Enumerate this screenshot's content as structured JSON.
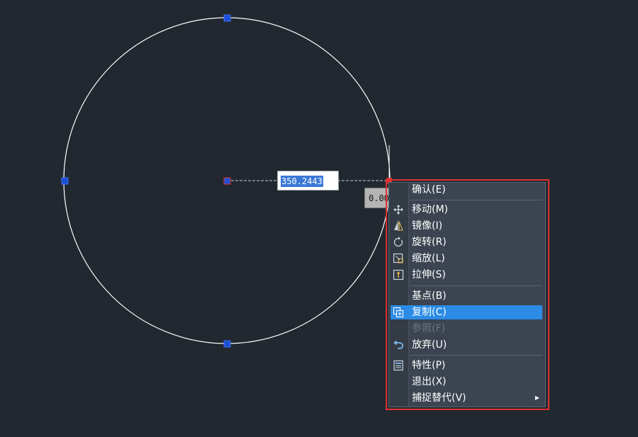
{
  "dimension_input": {
    "value": "350.2443"
  },
  "angle_input": {
    "value": "0.00"
  },
  "colors": {
    "background": "#212830",
    "grip": "#1e4fd8",
    "selection": "#2b8be6",
    "highlight_border": "#e03131"
  },
  "context_menu": {
    "items": [
      {
        "label": "确认(E)",
        "icon": null
      },
      {
        "label": "移动(M)",
        "icon": "move-icon"
      },
      {
        "label": "镜像(I)",
        "icon": "mirror-icon"
      },
      {
        "label": "旋转(R)",
        "icon": "rotate-icon"
      },
      {
        "label": "缩放(L)",
        "icon": "scale-icon"
      },
      {
        "label": "拉伸(S)",
        "icon": "stretch-icon"
      },
      {
        "label": "基点(B)",
        "icon": null
      },
      {
        "label": "复制(C)",
        "icon": "copy-icon",
        "state": "selected"
      },
      {
        "label": "参照(F)",
        "icon": null,
        "state": "disabled"
      },
      {
        "label": "放弃(U)",
        "icon": "undo-icon"
      },
      {
        "label": "特性(P)",
        "icon": "properties-icon"
      },
      {
        "label": "退出(X)",
        "icon": null
      },
      {
        "label": "捕捉替代(V)",
        "icon": null,
        "submenu": true
      }
    ]
  }
}
